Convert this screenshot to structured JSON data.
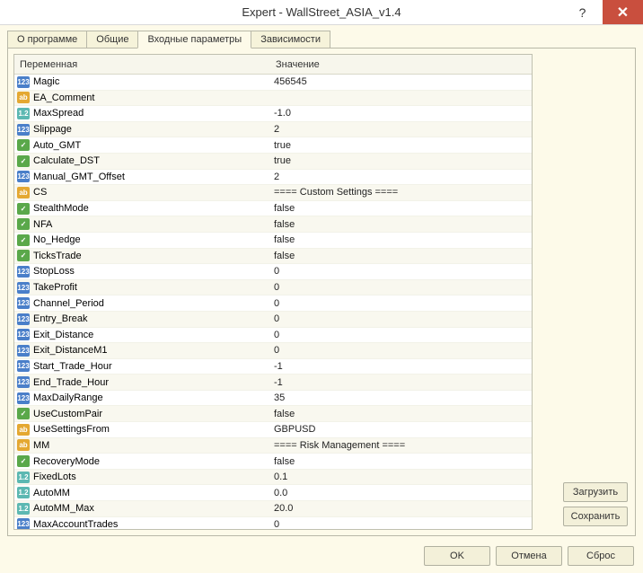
{
  "window": {
    "title": "Expert - WallStreet_ASIA_v1.4",
    "help": "?",
    "close": "✕"
  },
  "tabs": {
    "about": "О программе",
    "common": "Общие",
    "inputs": "Входные параметры",
    "deps": "Зависимости"
  },
  "headers": {
    "variable": "Переменная",
    "value": "Значение"
  },
  "side": {
    "load": "Загрузить",
    "save": "Сохранить"
  },
  "bottom": {
    "ok": "OK",
    "cancel": "Отмена",
    "reset": "Сброс"
  },
  "icons": {
    "int": "123",
    "str": "ab",
    "bool": "✓",
    "dbl": "1.2"
  },
  "rows": [
    {
      "t": "int",
      "name": "Magic",
      "val": "456545"
    },
    {
      "t": "str",
      "name": "EA_Comment",
      "val": ""
    },
    {
      "t": "dbl",
      "name": "MaxSpread",
      "val": "-1.0"
    },
    {
      "t": "int",
      "name": "Slippage",
      "val": "2"
    },
    {
      "t": "bool",
      "name": "Auto_GMT",
      "val": "true"
    },
    {
      "t": "bool",
      "name": "Calculate_DST",
      "val": "true"
    },
    {
      "t": "int",
      "name": "Manual_GMT_Offset",
      "val": "2"
    },
    {
      "t": "str",
      "name": "CS",
      "val": "==== Custom Settings ===="
    },
    {
      "t": "bool",
      "name": "StealthMode",
      "val": "false"
    },
    {
      "t": "bool",
      "name": "NFA",
      "val": "false"
    },
    {
      "t": "bool",
      "name": "No_Hedge",
      "val": "false"
    },
    {
      "t": "bool",
      "name": "TicksTrade",
      "val": "false"
    },
    {
      "t": "int",
      "name": "StopLoss",
      "val": "0"
    },
    {
      "t": "int",
      "name": "TakeProfit",
      "val": "0"
    },
    {
      "t": "int",
      "name": "Channel_Period",
      "val": "0"
    },
    {
      "t": "int",
      "name": "Entry_Break",
      "val": "0"
    },
    {
      "t": "int",
      "name": "Exit_Distance",
      "val": "0"
    },
    {
      "t": "int",
      "name": "Exit_DistanceM1",
      "val": "0"
    },
    {
      "t": "int",
      "name": "Start_Trade_Hour",
      "val": "-1"
    },
    {
      "t": "int",
      "name": "End_Trade_Hour",
      "val": "-1"
    },
    {
      "t": "int",
      "name": "MaxDailyRange",
      "val": "35"
    },
    {
      "t": "bool",
      "name": "UseCustomPair",
      "val": "false"
    },
    {
      "t": "str",
      "name": "UseSettingsFrom",
      "val": "GBPUSD"
    },
    {
      "t": "str",
      "name": "MM",
      "val": "==== Risk Management ===="
    },
    {
      "t": "bool",
      "name": "RecoveryMode",
      "val": "false"
    },
    {
      "t": "dbl",
      "name": "FixedLots",
      "val": "0.1"
    },
    {
      "t": "dbl",
      "name": "AutoMM",
      "val": "0.0"
    },
    {
      "t": "dbl",
      "name": "AutoMM_Max",
      "val": "20.0"
    },
    {
      "t": "int",
      "name": "MaxAccountTrades",
      "val": "0"
    }
  ]
}
